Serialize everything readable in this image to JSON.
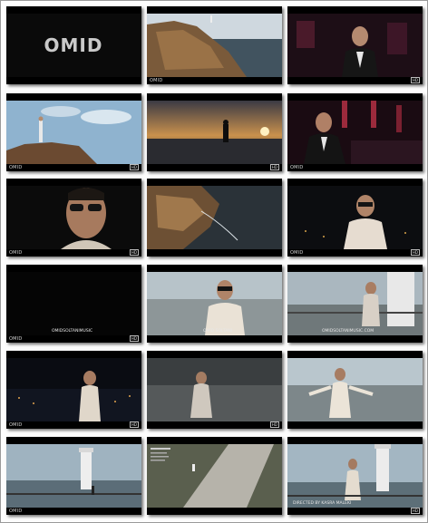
{
  "sheet": {
    "logo_text": "OMID",
    "watermark": "OMID",
    "hd_badge": "HD",
    "captions": {
      "row4_col1": "OMIDSOLTANIMUSIC",
      "row4_col2": "OMID SOLTANI",
      "row4_col3": "OMIDSOLTANIMUSIC.COM",
      "row6_col3": "DIRECTED BY KASRA MALEKI"
    }
  },
  "thumbnails": [
    {
      "id": "t1",
      "scene": "logo"
    },
    {
      "id": "t2",
      "scene": "rock-sea"
    },
    {
      "id": "t3",
      "scene": "singer-red-room"
    },
    {
      "id": "t4",
      "scene": "figure-on-rock"
    },
    {
      "id": "t5",
      "scene": "sunset-silhouette"
    },
    {
      "id": "t6",
      "scene": "singer-red-room-2"
    },
    {
      "id": "t7",
      "scene": "closeup-sunglasses"
    },
    {
      "id": "t8",
      "scene": "rocks-water-aerial"
    },
    {
      "id": "t9",
      "scene": "singer-night"
    },
    {
      "id": "t10",
      "scene": "dark"
    },
    {
      "id": "t11",
      "scene": "singer-city"
    },
    {
      "id": "t12",
      "scene": "singer-railing"
    },
    {
      "id": "t13",
      "scene": "night-city-singer"
    },
    {
      "id": "t14",
      "scene": "singer-fog"
    },
    {
      "id": "t15",
      "scene": "singer-arms-open"
    },
    {
      "id": "t16",
      "scene": "lighthouse-pier"
    },
    {
      "id": "t17",
      "scene": "road-aerial-credits"
    },
    {
      "id": "t18",
      "scene": "lighthouse-singer"
    }
  ]
}
